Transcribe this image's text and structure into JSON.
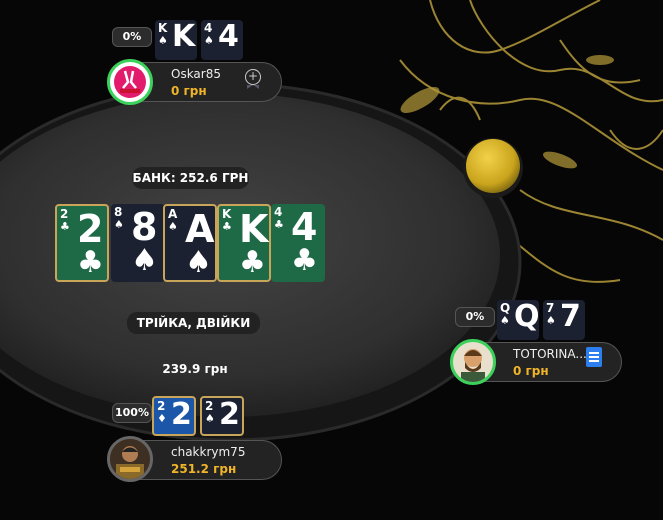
{
  "pot": {
    "label": "БАНК: 252.6 ГРН"
  },
  "hand_name": "ТРІЙКА, ДВІЙКИ",
  "bet_amount": "239.9 грн",
  "board": [
    {
      "rank": "2",
      "suit": "♣",
      "style": "green",
      "highlight": true
    },
    {
      "rank": "8",
      "suit": "♠",
      "style": "dark",
      "highlight": false
    },
    {
      "rank": "A",
      "suit": "♠",
      "style": "dark",
      "highlight": true
    },
    {
      "rank": "K",
      "suit": "♣",
      "style": "green",
      "highlight": true
    },
    {
      "rank": "4",
      "suit": "♣",
      "style": "green",
      "highlight": false
    }
  ],
  "players": {
    "top": {
      "name": "Oskar85",
      "stack": "0 грн",
      "equity": "0%",
      "cards": [
        {
          "rank": "K",
          "suit": "♠"
        },
        {
          "rank": "4",
          "suit": "♠"
        }
      ],
      "icon": "plus-circle-icon"
    },
    "right": {
      "name": "TOTORINA...",
      "stack": "0 грн",
      "equity": "0%",
      "cards": [
        {
          "rank": "Q",
          "suit": "♠"
        },
        {
          "rank": "7",
          "suit": "♠"
        }
      ],
      "icon": "note-icon"
    },
    "bottom": {
      "name": "chakkrym75",
      "stack": "251.2 грн",
      "equity": "100%",
      "cards": [
        {
          "rank": "2",
          "suit": "♦"
        },
        {
          "rank": "2",
          "suit": "♠"
        }
      ]
    }
  },
  "colors": {
    "gold": "#f0b429",
    "felt": "#3a3a3a",
    "highlight": "#c9a55a",
    "green_ring": "#3bd15a"
  }
}
